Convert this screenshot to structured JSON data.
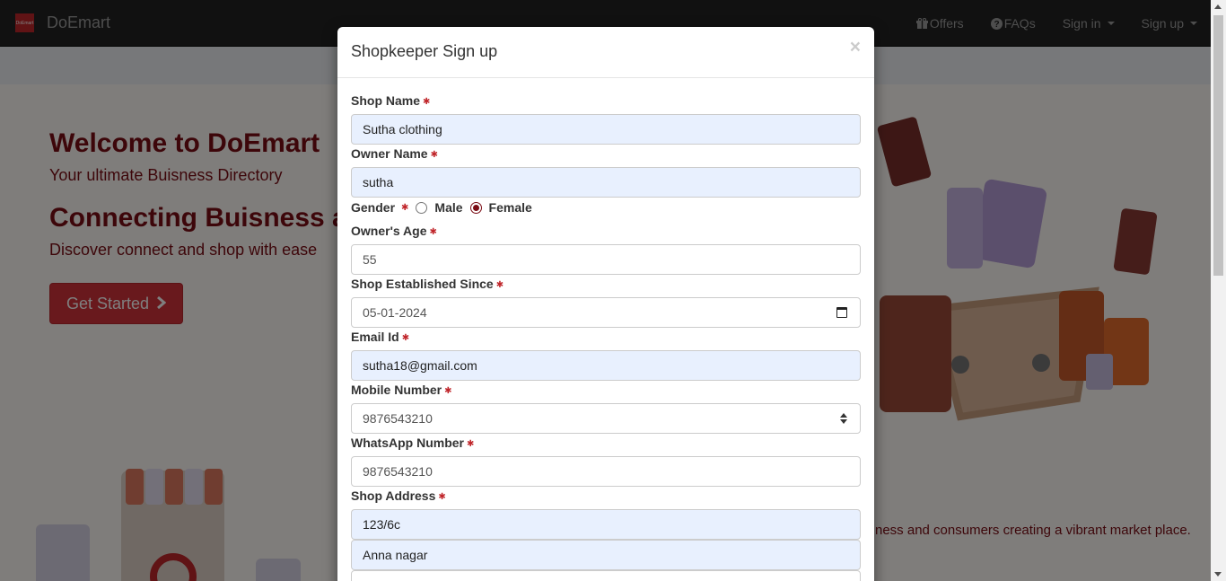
{
  "navbar": {
    "brand_logo_text": "DoEmart",
    "brand": "DoEmart",
    "links": [
      {
        "label": "Offers",
        "icon": "gift-icon"
      },
      {
        "label": "FAQs",
        "icon": "question-circle-icon"
      },
      {
        "label": "Sign in",
        "dropdown": true
      },
      {
        "label": "Sign up",
        "dropdown": true
      }
    ]
  },
  "hero": {
    "title": "Welcome to DoEmart",
    "subtitle": "Your ultimate Buisness Directory",
    "title2": "Connecting Buisness a",
    "subtitle2": "Discover connect and shop with ease",
    "cta_label": "Get Started",
    "about_fragment": "ness and consumers creating a vibrant market place."
  },
  "modal": {
    "title": "Shopkeeper Sign up",
    "close": "×",
    "required_mark": "✱",
    "fields": {
      "shop_name": {
        "label": "Shop Name",
        "value": "Sutha clothing"
      },
      "owner_name": {
        "label": "Owner Name",
        "value": "sutha"
      },
      "gender": {
        "label": "Gender",
        "options": [
          "Male",
          "Female"
        ],
        "selected": "Female"
      },
      "owner_age": {
        "label": "Owner's Age",
        "value": "55"
      },
      "established": {
        "label": "Shop Established Since",
        "value": "05-01-2024"
      },
      "email": {
        "label": "Email Id",
        "value": "sutha18@gmail.com"
      },
      "mobile": {
        "label": "Mobile Number",
        "value": "9876543210"
      },
      "whatsapp": {
        "label": "WhatsApp Number",
        "value": "9876543210"
      },
      "address": {
        "label": "Shop Address",
        "line1": "123/6c",
        "line2": "Anna nagar",
        "line3": ""
      }
    }
  },
  "colors": {
    "accent": "#7a0c14",
    "button": "#d3333b",
    "navbar": "#222222",
    "autofill": "#e8f0fe"
  }
}
